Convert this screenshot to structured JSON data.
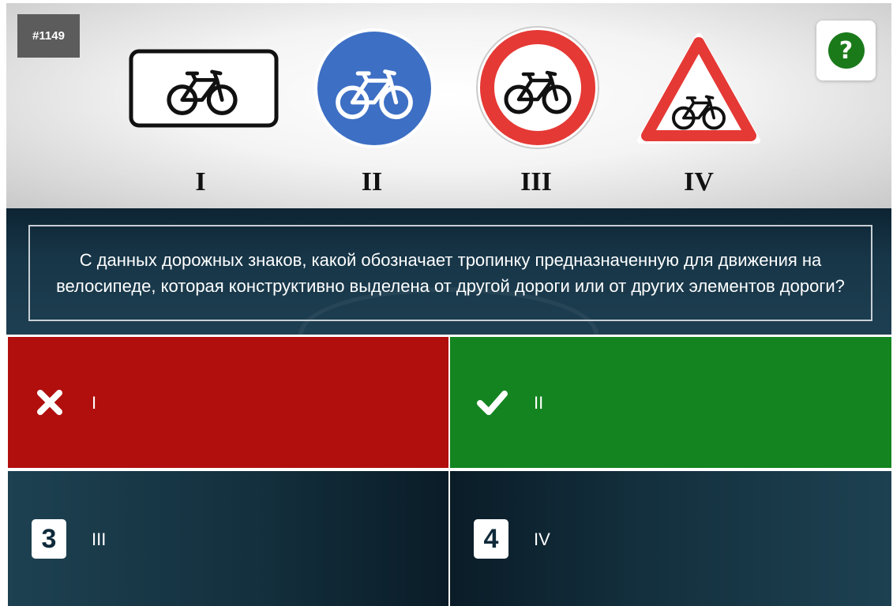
{
  "question": {
    "id": "#1149",
    "text": "С данных дорожных знаков, какой обозначает тропинку предназначенную для движения на велосипеде, которая конструктивно выделена от другой дороги или от других элементов дороги?"
  },
  "help": {
    "icon": "question-mark-icon",
    "symbol": "?"
  },
  "signs": [
    {
      "numeral": "I",
      "icon": "bicycle-rectangular-sign-icon"
    },
    {
      "numeral": "II",
      "icon": "bicycle-blue-circle-sign-icon",
      "color": "#3d6fc4"
    },
    {
      "numeral": "III",
      "icon": "bicycle-prohibition-sign-icon",
      "color": "#e53935"
    },
    {
      "numeral": "IV",
      "icon": "bicycle-warning-triangle-sign-icon",
      "color": "#e53935"
    }
  ],
  "answers": [
    {
      "marker": "cross-icon",
      "label": "I",
      "state": "wrong",
      "color": "#b00f0e"
    },
    {
      "marker": "checkmark-icon",
      "label": "II",
      "state": "correct",
      "color": "#148420"
    },
    {
      "marker": "3",
      "label": "III",
      "state": "neutral"
    },
    {
      "marker": "4",
      "label": "IV",
      "state": "neutral"
    }
  ]
}
